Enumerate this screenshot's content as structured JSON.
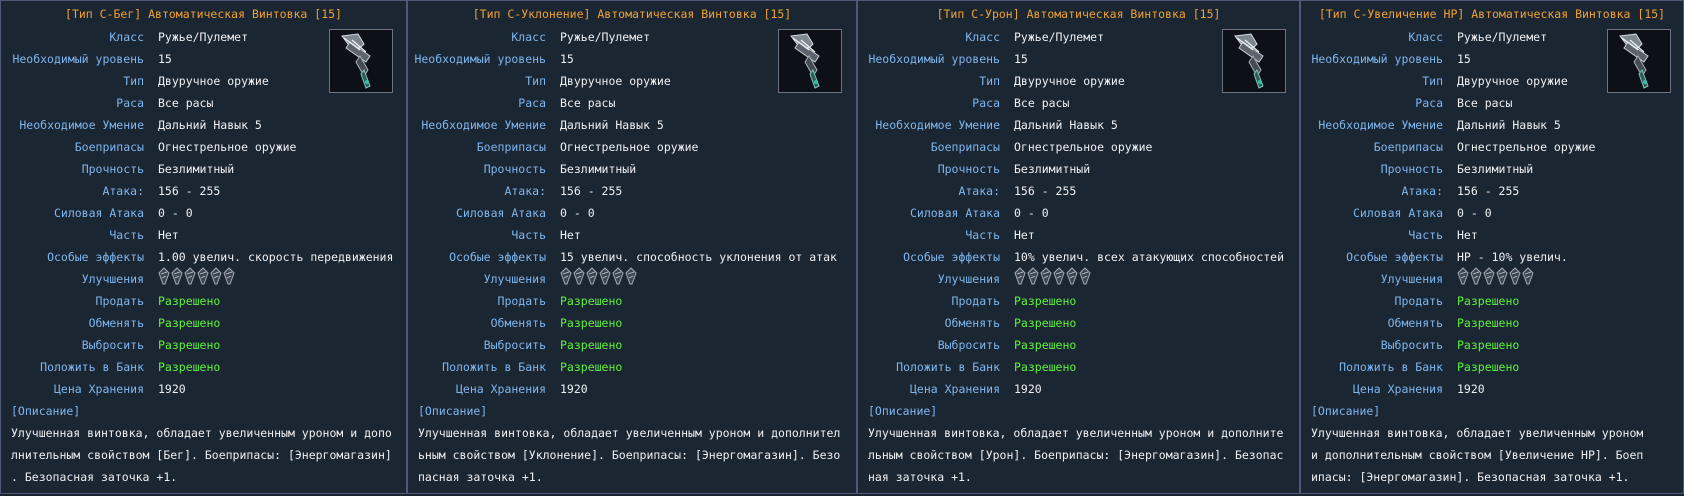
{
  "labels": {
    "class": "Класс",
    "level": "Необходимый уровень",
    "type": "Тип",
    "race": "Раса",
    "skill": "Необходимое Умение",
    "ammo": "Боеприпасы",
    "durability": "Прочность",
    "attack": "Атака:",
    "force_attack": "Силовая Атака",
    "part": "Часть",
    "effects": "Особые эффекты",
    "upgrades": "Улучшения",
    "sell": "Продать",
    "trade": "Обменять",
    "drop": "Выбросить",
    "bank": "Положить в Банк",
    "storage_price": "Цена Хранения",
    "description_header": "[Описание]"
  },
  "icons": {
    "item": "rifle-icon",
    "upgrade_slot": "empty-upgrade-slot-icon"
  },
  "colors": {
    "title": "#f0a132",
    "label": "#7fb6ee",
    "value": "#eef0f2",
    "allowed": "#5ef23a",
    "border": "#4e5a78",
    "background": "#1b2633"
  },
  "items": [
    {
      "title": "[Тип С-Бег] Автоматическая Винтовка [15]",
      "class": "Ружье/Пулемет",
      "level": "15",
      "type": "Двуручное оружие",
      "race": "Все расы",
      "skill": "Дальний Навык 5",
      "ammo": "Огнестрельное оружие",
      "durability": "Безлимитный",
      "attack": "156 - 255",
      "force_attack": "0 - 0",
      "part": "Нет",
      "effects": "1.00 увелич. скорость передвижения",
      "upgrade_slots": 6,
      "sell": "Разрешено",
      "trade": "Разрешено",
      "drop": "Разрешено",
      "bank": "Разрешено",
      "storage_price": "1920",
      "description_lines": [
        "Улучшенная винтовка, обладает увеличенным уроном и допо",
        "лнительным свойством [Бег]. Боеприпасы: [Энергомагазин]",
        ". Безопасная заточка +1."
      ]
    },
    {
      "title": "[Тип С-Уклонение] Автоматическая Винтовка [15]",
      "class": "Ружье/Пулемет",
      "level": "15",
      "type": "Двуручное оружие",
      "race": "Все расы",
      "skill": "Дальний Навык 5",
      "ammo": "Огнестрельное оружие",
      "durability": "Безлимитный",
      "attack": "156 - 255",
      "force_attack": "0 - 0",
      "part": "Нет",
      "effects": "15 увелич. способность уклонения от атак",
      "upgrade_slots": 6,
      "sell": "Разрешено",
      "trade": "Разрешено",
      "drop": "Разрешено",
      "bank": "Разрешено",
      "storage_price": "1920",
      "description_lines": [
        "Улучшенная винтовка, обладает увеличенным уроном и дополнител",
        "ьным свойством [Уклонение]. Боеприпасы: [Энергомагазин]. Безо",
        "пасная заточка +1."
      ]
    },
    {
      "title": "[Тип С-Урон] Автоматическая Винтовка [15]",
      "class": "Ружье/Пулемет",
      "level": "15",
      "type": "Двуручное оружие",
      "race": "Все расы",
      "skill": "Дальний Навык 5",
      "ammo": "Огнестрельное оружие",
      "durability": "Безлимитный",
      "attack": "156 - 255",
      "force_attack": "0 - 0",
      "part": "Нет",
      "effects": "10% увелич. всех атакующих способностей",
      "upgrade_slots": 6,
      "sell": "Разрешено",
      "trade": "Разрешено",
      "drop": "Разрешено",
      "bank": "Разрешено",
      "storage_price": "1920",
      "description_lines": [
        "Улучшенная винтовка, обладает увеличенным уроном и дополните",
        "льным свойством [Урон]. Боеприпасы: [Энергомагазин]. Безопас",
        "ная заточка +1."
      ]
    },
    {
      "title": "[Тип С-Увеличение HP] Автоматическая Винтовка [15]",
      "class": "Ружье/Пулемет",
      "level": "15",
      "type": "Двуручное оружие",
      "race": "Все расы",
      "skill": "Дальний Навык 5",
      "ammo": "Огнестрельное оружие",
      "durability": "Безлимитный",
      "attack": "156 - 255",
      "force_attack": "0 - 0",
      "part": "Нет",
      "effects": "HP - 10% увелич.",
      "upgrade_slots": 6,
      "sell": "Разрешено",
      "trade": "Разрешено",
      "drop": "Разрешено",
      "bank": "Разрешено",
      "storage_price": "1920",
      "description_lines": [
        "Улучшенная винтовка, обладает увеличенным уроном",
        "и дополнительным свойством [Увеличение HP]. Боеп",
        "ипасы: [Энергомагазин]. Безопасная заточка +1."
      ]
    }
  ]
}
